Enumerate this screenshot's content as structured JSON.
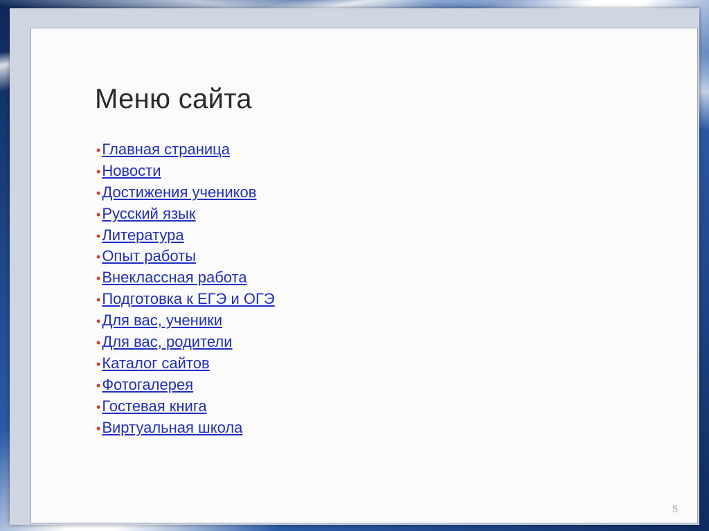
{
  "slide": {
    "title": "Меню сайта",
    "page_number": "5",
    "bullet_color": "#d83a2e",
    "link_color": "#1f2fc4",
    "menu_items": [
      {
        "label": "Главная страница"
      },
      {
        "label": "Новости"
      },
      {
        "label": "Достижения учеников"
      },
      {
        "label": "Русский язык"
      },
      {
        "label": "Литература"
      },
      {
        "label": "Опыт работы"
      },
      {
        "label": "Внеклассная работа"
      },
      {
        "label": "Подготовка к ЕГЭ и ОГЭ"
      },
      {
        "label": "Для вас, ученики"
      },
      {
        "label": "Для вас, родители"
      },
      {
        "label": "Каталог сайтов"
      },
      {
        "label": "Фотогалерея"
      },
      {
        "label": "Гостевая книга"
      },
      {
        "label": "Виртуальная школа"
      }
    ]
  }
}
